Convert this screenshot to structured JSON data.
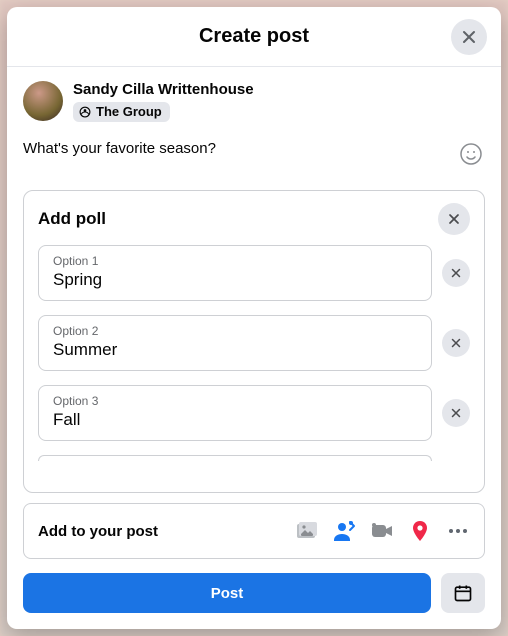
{
  "header": {
    "title": "Create post"
  },
  "user": {
    "name": "Sandy Cilla Writtenhouse",
    "audience": "The Group"
  },
  "composer": {
    "text": "What's your favorite season?"
  },
  "poll": {
    "title": "Add poll",
    "options": [
      {
        "label": "Option 1",
        "value": "Spring"
      },
      {
        "label": "Option 2",
        "value": "Summer"
      },
      {
        "label": "Option 3",
        "value": "Fall"
      }
    ]
  },
  "addToPost": {
    "label": "Add to your post"
  },
  "footer": {
    "postLabel": "Post"
  }
}
